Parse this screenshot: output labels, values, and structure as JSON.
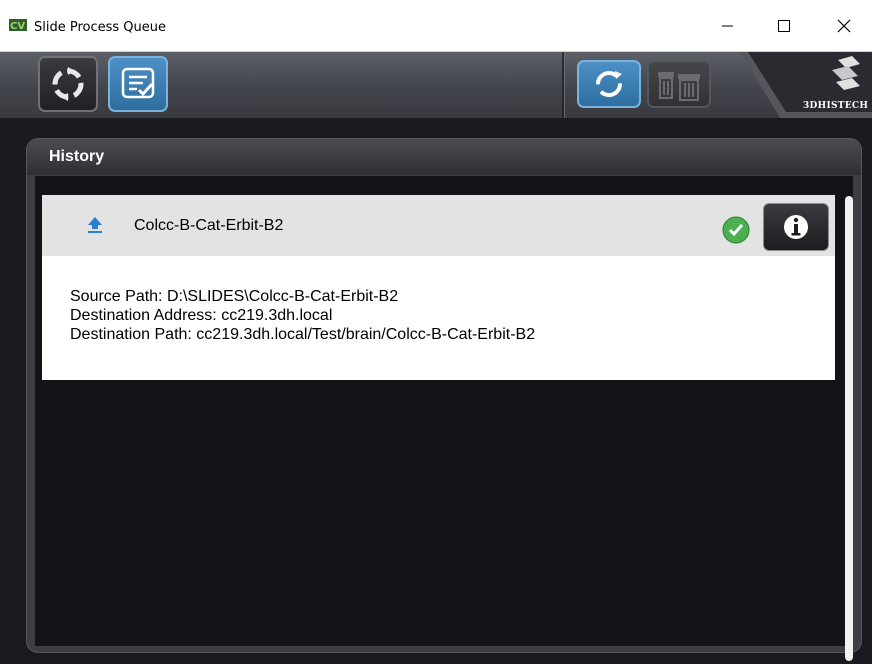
{
  "window": {
    "title": "Slide Process Queue"
  },
  "toolbar": {
    "buttons": [
      {
        "icon": "process-arrows-icon",
        "state": "normal"
      },
      {
        "icon": "history-list-icon",
        "state": "selected"
      },
      {
        "icon": "refresh-icon",
        "state": "active"
      },
      {
        "icon": "delete-icon",
        "state": "disabled"
      }
    ],
    "brand": "3DHISTECH"
  },
  "history": {
    "title": "History",
    "items": [
      {
        "name": "Colcc-B-Cat-Erbit-B2",
        "status": "completed",
        "details": [
          "Source Path: D:\\SLIDES\\Colcc-B-Cat-Erbit-B2",
          "Destination Address: cc219.3dh.local",
          "Destination Path: cc219.3dh.local/Test/brain/Colcc-B-Cat-Erbit-B2"
        ]
      }
    ]
  },
  "colors": {
    "accent_blue": "#3a80b8",
    "success_green": "#4caf50",
    "panel_dark": "#131418"
  }
}
